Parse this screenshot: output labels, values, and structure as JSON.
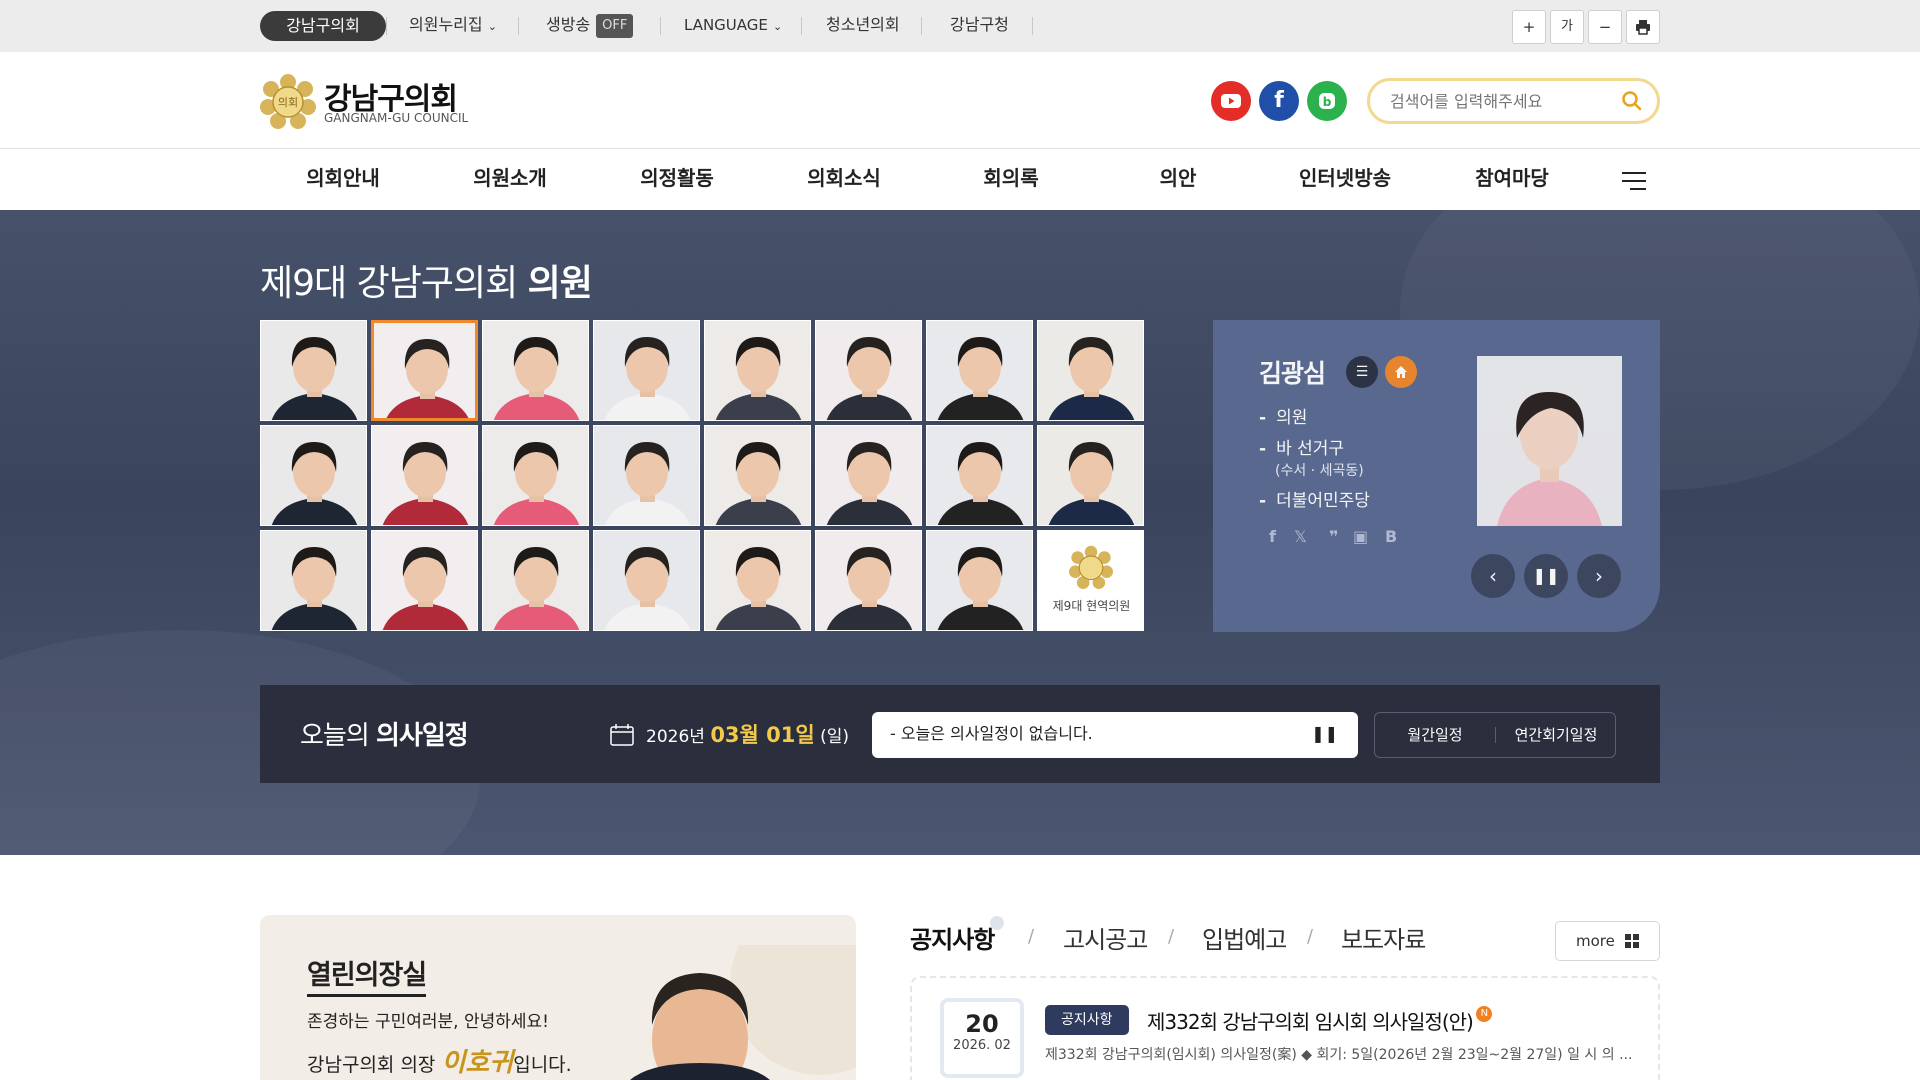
{
  "util": {
    "home_label": "강남구의회",
    "archive_label": "의원누리집",
    "live_label": "생방송",
    "live_state": "OFF",
    "language_label": "LANGUAGE",
    "youth_label": "청소년의회",
    "office_label": "강남구청",
    "font_medium_label": "가"
  },
  "header": {
    "logo_title": "강남구의회",
    "logo_subtitle": "GANGNAM-GU COUNCIL",
    "emblem_text": "의회",
    "search_placeholder": "검색어를 입력해주세요",
    "sns": [
      "youtube-icon",
      "facebook-icon",
      "blog-icon"
    ],
    "colors": {
      "youtube": "#e52d27",
      "facebook": "#1f4fa8",
      "blog": "#2bb24c"
    }
  },
  "gnb": {
    "items": [
      "의회안내",
      "의원소개",
      "의정활동",
      "의회소식",
      "회의록",
      "의안",
      "인터넷방송",
      "참여마당"
    ]
  },
  "visual": {
    "title_prefix": "제9대 강남구의회",
    "title_bold": "의원",
    "current_members_label": "제9대 현역의원",
    "member_count": 23,
    "selected_index": 1
  },
  "card": {
    "name": "김광심",
    "role": "의원",
    "district": "바 선거구",
    "district_detail": "(수서 · 세곡동)",
    "party": "더불어민주당"
  },
  "schedule": {
    "title_prefix": "오늘의",
    "title_bold": "의사일정",
    "year": "2026년",
    "month_day": "03월 01일",
    "weekday": "(일)",
    "message": "- 오늘은 의사일정이 없습니다.",
    "monthly_label": "월간일정",
    "yearly_label": "연간회기일정"
  },
  "open_room": {
    "title": "열린의장실",
    "greeting": "존경하는 구민여러분, 안녕하세요!",
    "sign_prefix": "강남구의회 의장",
    "sign_name": "이호귀",
    "sign_suffix": "입니다."
  },
  "news": {
    "tabs": [
      "공지사항",
      "고시공고",
      "입법예고",
      "보도자료"
    ],
    "more_label": "more",
    "item": {
      "day": "20",
      "year_month": "2026. 02",
      "category": "공지사항",
      "title": "제332회 강남구의회 임시회 의사일정(안)",
      "new_badge": "N",
      "desc": "제332회 강남구의회(임시회) 의사일정(案) ◆ 회기: 5일(2026년 2월 23일~2월 27일) 일 시 의 ..."
    }
  }
}
